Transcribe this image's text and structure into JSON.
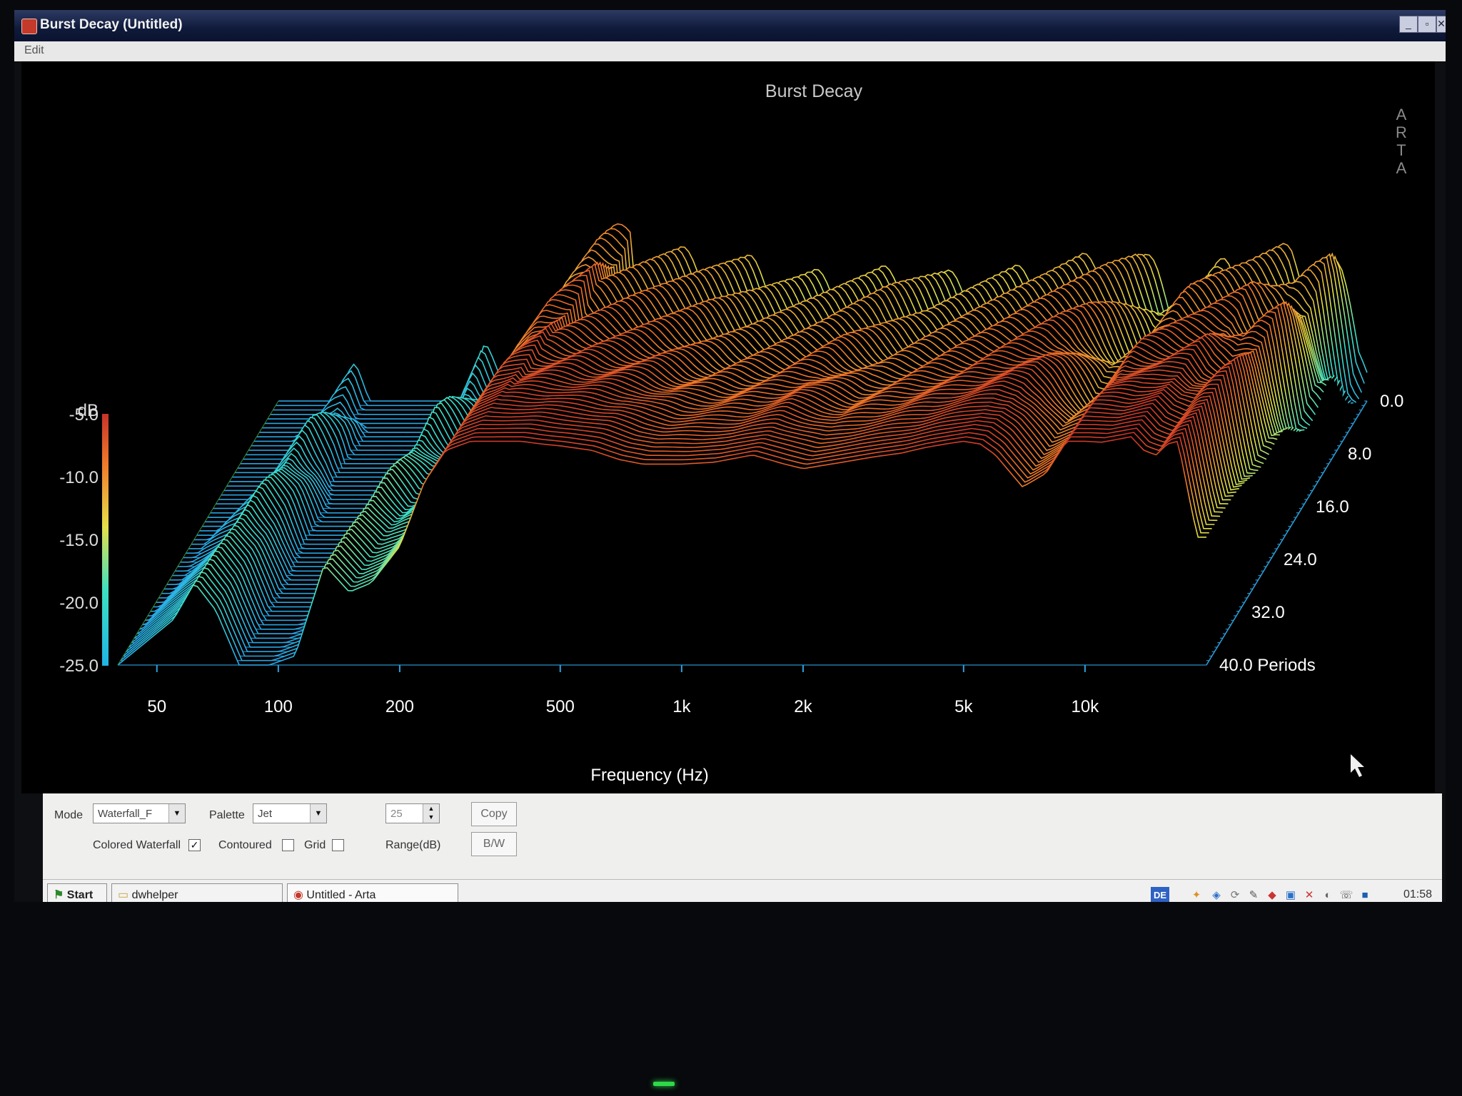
{
  "window": {
    "title": "Burst Decay  (Untitled)",
    "buttons": [
      "_",
      "▫",
      "✕"
    ]
  },
  "menu": {
    "edit": "Edit"
  },
  "chart_data": {
    "type": "waterfall",
    "title": "Burst Decay",
    "watermark": "ARTA",
    "xlabel": "Frequency (Hz)",
    "x_tick_labels": [
      "50",
      "100",
      "200",
      "500",
      "1k",
      "2k",
      "5k",
      "10k"
    ],
    "x_ticks_hz": [
      50,
      100,
      200,
      500,
      1000,
      2000,
      5000,
      10000
    ],
    "xlim_hz": [
      40,
      20000
    ],
    "x_scale": "log",
    "ylabel": "dB",
    "y_tick_labels": [
      "-5.0",
      "-10.0",
      "-15.0",
      "-20.0",
      "-25.0"
    ],
    "y_ticks": [
      -5,
      -10,
      -15,
      -20,
      -25
    ],
    "ylim": [
      -25,
      0
    ],
    "z_tick_labels": [
      "0.0",
      "8.0",
      "16.0",
      "24.0",
      "32.0",
      "40.0 Periods"
    ],
    "z_ticks": [
      0,
      8,
      16,
      24,
      32,
      40
    ],
    "zlim": [
      0,
      40
    ],
    "palette": "Jet",
    "front_slice_db": {
      "freq_hz": [
        40,
        55,
        62,
        70,
        80,
        95,
        110,
        130,
        150,
        170,
        200,
        230,
        260,
        300,
        350,
        400,
        450,
        500,
        600,
        700,
        800,
        1000,
        1200,
        1500,
        1800,
        2000,
        2500,
        3000,
        3500,
        4000,
        4500,
        5000,
        5500,
        6000,
        7000,
        8000,
        9000,
        10000,
        11000,
        12000,
        13000,
        14000,
        15000,
        16000,
        17000,
        18000,
        19000,
        20000
      ],
      "level_db": [
        -25,
        -20,
        -16,
        -19,
        -25,
        -25,
        -24,
        -14,
        -17,
        -16,
        -12,
        -5,
        -1.5,
        -0.5,
        -0.5,
        -0.5,
        -0.8,
        -1,
        -1.5,
        -2.5,
        -3,
        -3,
        -2.8,
        -2,
        -3,
        -3.5,
        -2.8,
        -2.2,
        -1.8,
        -1.2,
        -0.8,
        -0.5,
        -0.8,
        -2,
        -5.5,
        -4,
        -0.5,
        -0.5,
        -0.6,
        -0.3,
        0,
        -1.5,
        -2,
        -0.8,
        -0.5,
        -6,
        -11,
        -11
      ]
    }
  },
  "controls": {
    "mode_label": "Mode",
    "mode_value": "Waterfall_F",
    "palette_label": "Palette",
    "palette_value": "Jet",
    "range_value": "25",
    "range_label": "Range(dB)",
    "copy_label": "Copy",
    "bw_label": "B/W",
    "colored_waterfall_label": "Colored Waterfall",
    "colored_waterfall_checked": "✓",
    "contoured_label": "Contoured",
    "grid_label": "Grid"
  },
  "taskbar": {
    "start_label": "Start",
    "items": [
      "dwhelper",
      "Untitled - Arta"
    ],
    "language": "DE",
    "clock": "01:58"
  }
}
